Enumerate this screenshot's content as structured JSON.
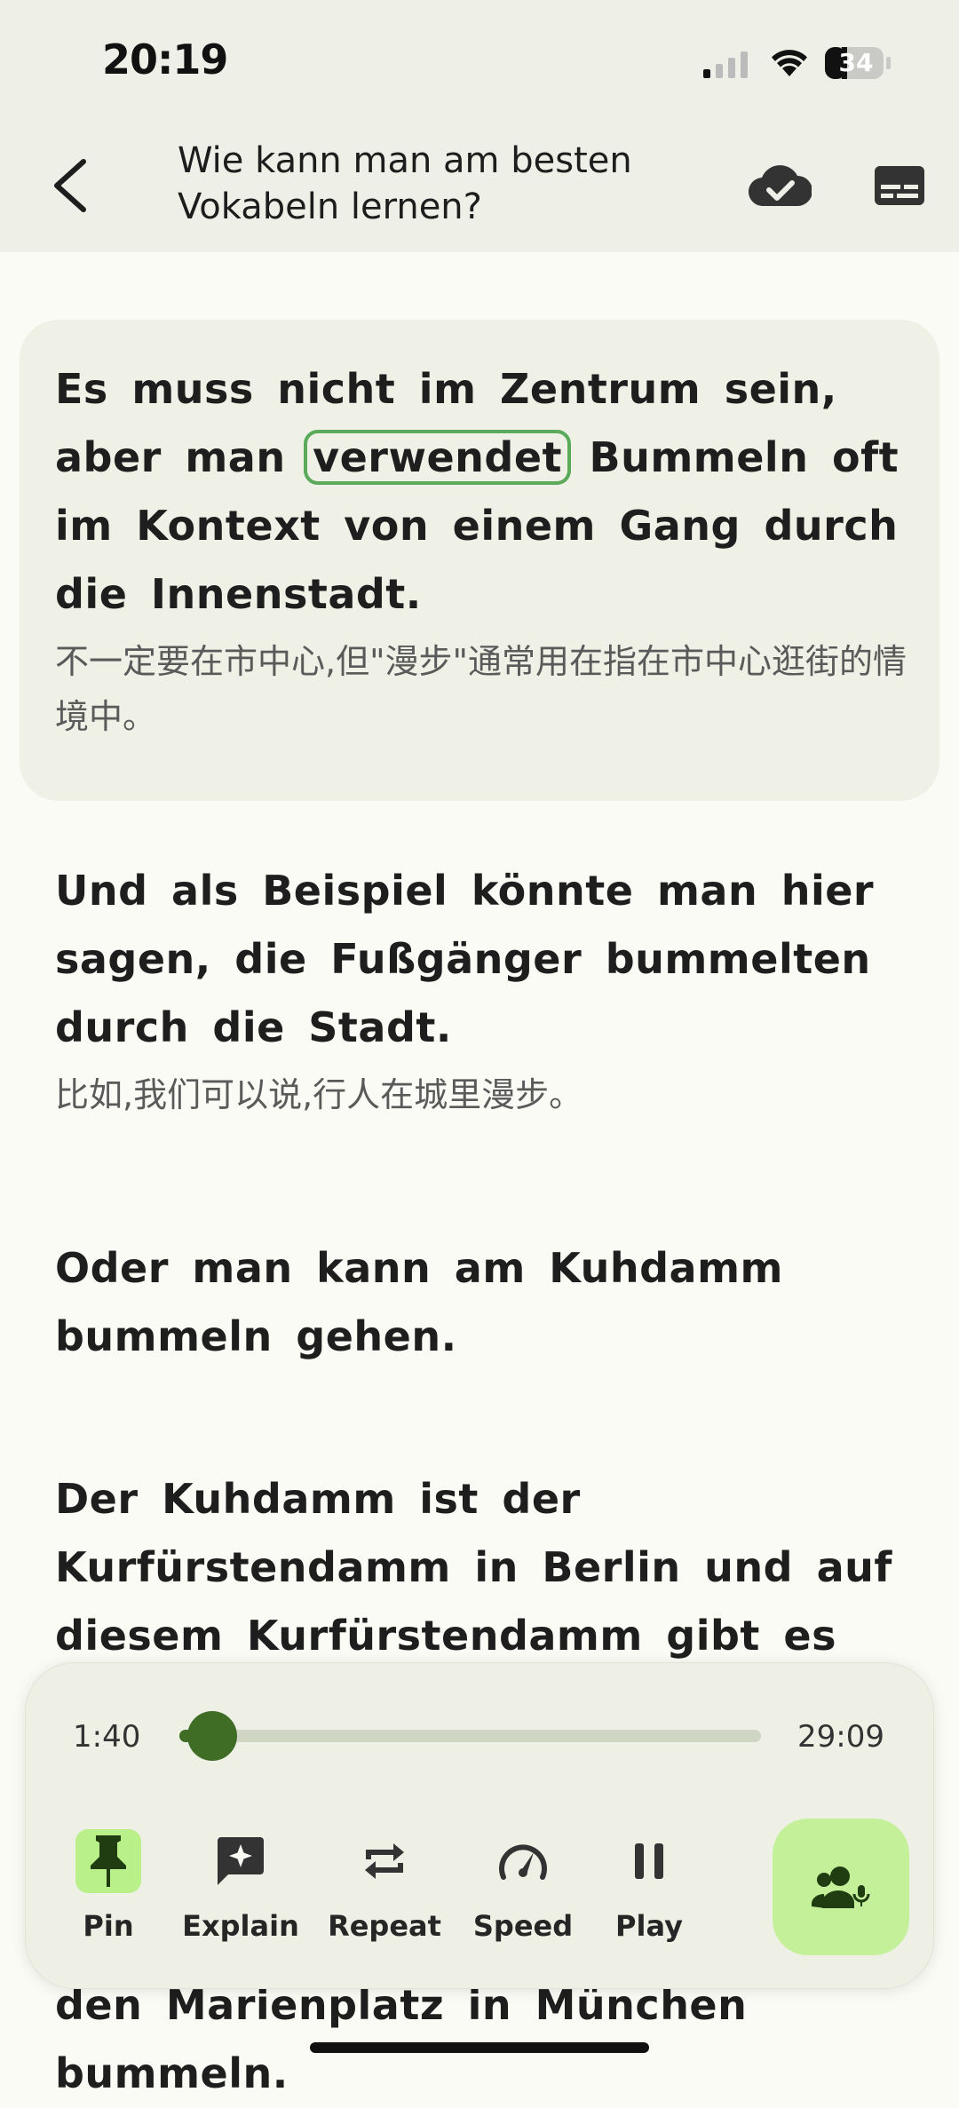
{
  "status": {
    "time": "20:19",
    "battery": "34"
  },
  "header": {
    "title": "Wie kann man am besten Vokabeln lernen?"
  },
  "transcript": [
    {
      "de_before": "Es muss nicht im Zentrum sein, aber man ",
      "de_highlight": "verwendet",
      "de_after": " Bummeln oft im Kontext von einem Gang durch die Innenstadt.",
      "zh": "不一定要在市中心,但\"漫步\"通常用在指在市中心逛街的情境中。"
    },
    {
      "de": "Und als Beispiel könnte man hier sagen, die Fußgänger bummelten durch die Stadt.",
      "zh": "比如,我们可以说,行人在城里漫步。"
    },
    {
      "de": "Oder man kann am Kuhdamm bummeln gehen."
    },
    {
      "de": "Der Kuhdamm ist der Kurfürstendamm in Berlin und auf diesem Kurfürstendamm gibt es"
    },
    {
      "de": "den Marienplatz in München bummeln."
    }
  ],
  "player": {
    "elapsed": "1:40",
    "total": "29:09",
    "progress": 0.057,
    "controls": [
      {
        "label": "Pin",
        "icon": "pin-icon",
        "active": true
      },
      {
        "label": "Explain",
        "icon": "explain-sparkle-icon",
        "active": false
      },
      {
        "label": "Repeat",
        "icon": "repeat-icon",
        "active": false
      },
      {
        "label": "Speed",
        "icon": "speed-gauge-icon",
        "active": false
      },
      {
        "label": "Play",
        "icon": "pause-icon",
        "active": false
      }
    ],
    "accent": "#3f6d26",
    "highlight_bg": "#b9f08a"
  }
}
